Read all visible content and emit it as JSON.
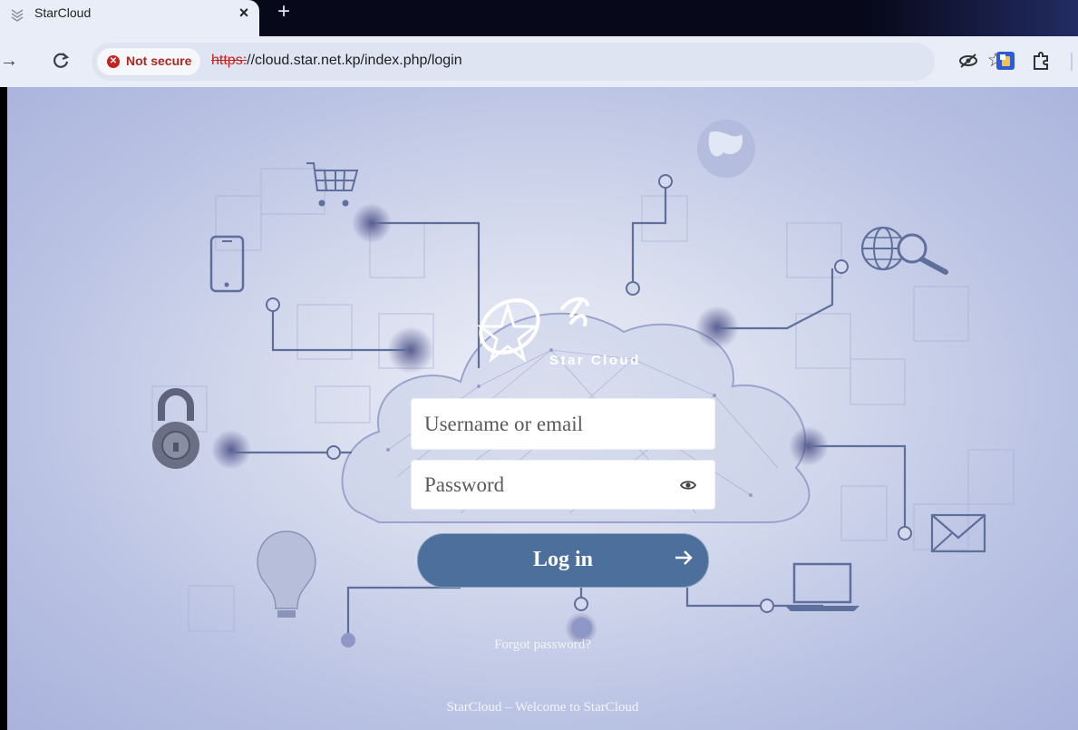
{
  "browser": {
    "tab_title": "StarCloud",
    "tab_close": "×",
    "new_tab": "+",
    "security_label": "Not secure",
    "url_scheme": "https:",
    "url_rest": "//cloud.star.net.kp/index.php/login",
    "accent_danger": "#c5221f"
  },
  "login": {
    "logo_text": "Star Cloud",
    "username_placeholder": "Username or email",
    "password_placeholder": "Password",
    "submit_label": "Log in",
    "forgot_link": "Forgot password?",
    "button_color": "#4d6f9b"
  },
  "footer": {
    "text": "StarCloud – Welcome to StarCloud"
  }
}
